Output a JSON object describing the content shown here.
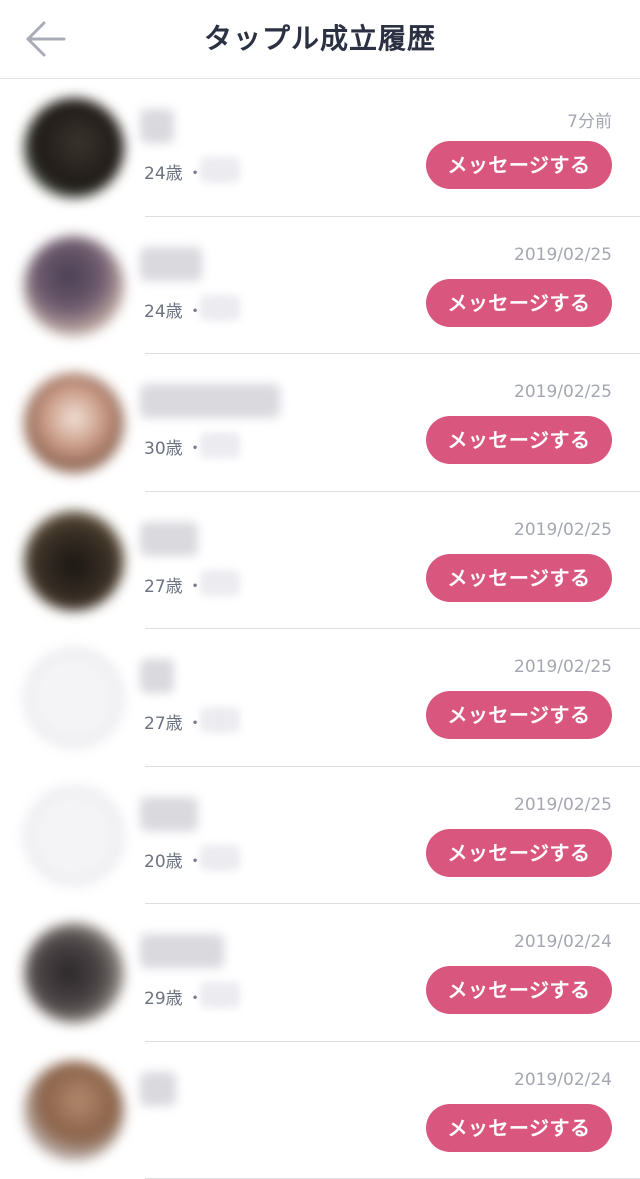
{
  "header": {
    "title": "タップル成立履歴",
    "back_icon": "arrow-left-icon"
  },
  "colors": {
    "accent": "#d9577f",
    "title_text": "#2b3142",
    "secondary_text": "#6d7280",
    "date_text": "#a4a7b0"
  },
  "matches": [
    {
      "age": "24歳",
      "separator": "・",
      "date": "7分前",
      "button": "メッセージする"
    },
    {
      "age": "24歳",
      "separator": "・",
      "date": "2019/02/25",
      "button": "メッセージする"
    },
    {
      "age": "30歳",
      "separator": "・",
      "date": "2019/02/25",
      "button": "メッセージする"
    },
    {
      "age": "27歳",
      "separator": "・",
      "date": "2019/02/25",
      "button": "メッセージする"
    },
    {
      "age": "27歳",
      "separator": "・",
      "date": "2019/02/25",
      "button": "メッセージする"
    },
    {
      "age": "20歳",
      "separator": "・",
      "date": "2019/02/25",
      "button": "メッセージする"
    },
    {
      "age": "29歳",
      "separator": "・",
      "date": "2019/02/24",
      "button": "メッセージする"
    },
    {
      "age": "",
      "separator": "",
      "date": "2019/02/24",
      "button": "メッセージする"
    }
  ]
}
